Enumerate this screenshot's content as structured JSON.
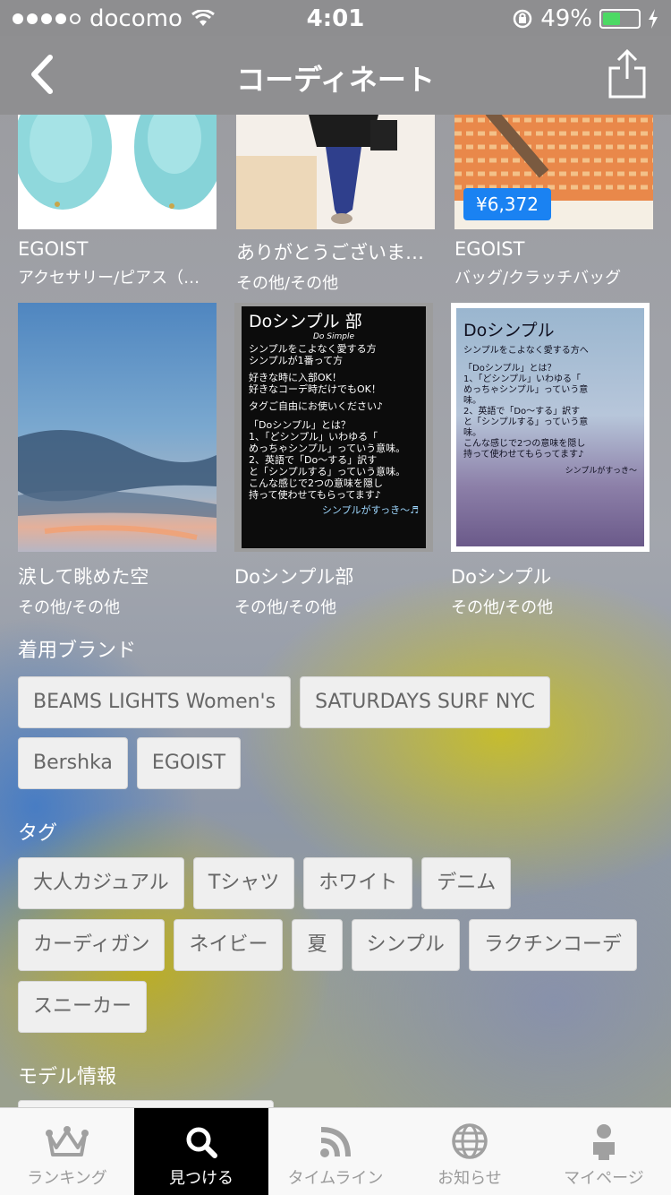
{
  "status_bar": {
    "carrier": "docomo",
    "time": "4:01",
    "battery": "49%",
    "battery_level": 0.49
  },
  "nav": {
    "title": "コーディネート"
  },
  "cards_row1": [
    {
      "title": "EGOIST",
      "category": "アクセサリー/ピアス（…",
      "price": ""
    },
    {
      "title": "ありがとうございま…",
      "category": "その他/その他",
      "price": ""
    },
    {
      "title": "EGOIST",
      "category": "バッグ/クラッチバッグ",
      "price": "¥6,372"
    }
  ],
  "cards_row2": [
    {
      "title": "涙して眺めた空",
      "category": "その他/その他"
    },
    {
      "title": "Doシンプル部",
      "category": "その他/その他"
    },
    {
      "title": "Doシンプル",
      "category": "その他/その他"
    }
  ],
  "brands": {
    "title": "着用ブランド",
    "items": [
      "BEAMS LIGHTS Women's",
      "SATURDAYS SURF NYC",
      "Bershka",
      "EGOIST"
    ]
  },
  "tags": {
    "title": "タグ",
    "items": [
      "大人カジュアル",
      "Tシャツ",
      "ホワイト",
      "デニム",
      "カーディガン",
      "ネイビー",
      "夏",
      "シンプル",
      "ラクチンコーデ",
      "スニーカー"
    ]
  },
  "model_info": {
    "title": "モデル情報"
  },
  "image_texts": {
    "doshinpurubu": [
      "Doシンプル 部",
      "Do Simple",
      "シンプルをこよなく愛する方",
      "シンプルが1番って方",
      "好きな時に入部OK！",
      "好きなコーデ時だけでもOK！",
      "タグご自由にお使いください♪",
      "「Doシンプル」とは？",
      "1、「どシンプル」いわゆる「",
      "めっちゃシンプル」っていう意味。",
      "2、英語で「Do～する」訳す",
      "と「シンプルする」っていう意味。",
      "こんな感じで2つの意味を隠し",
      "持って使わせてもらってます♪",
      "シンプルがすっき～♬"
    ],
    "doshinpuru": [
      "Doシンプル",
      "シンプルをこよなく愛する方へ",
      "「Doシンプル」とは？",
      "1、「どシンプル」いわゆる「",
      "めっちゃシンプル」っていう意",
      "味。",
      "2、英語で「Do～する」訳す",
      "と「シンプルする」っていう意",
      "味。",
      "こんな感じで2つの意味を隠し",
      "持って使わせてもらってます♪",
      "シンプルがすっき～"
    ]
  },
  "tabbar": {
    "items": [
      {
        "label": "ランキング",
        "icon": "crown-icon"
      },
      {
        "label": "見つける",
        "icon": "search-icon"
      },
      {
        "label": "タイムライン",
        "icon": "rss-icon"
      },
      {
        "label": "お知らせ",
        "icon": "globe-icon"
      },
      {
        "label": "マイページ",
        "icon": "user-icon"
      }
    ],
    "active": "見つける"
  },
  "colors": {
    "price_badge": "#1a82f2",
    "battery": "#4cd964",
    "tab_active_bg": "#000000"
  }
}
